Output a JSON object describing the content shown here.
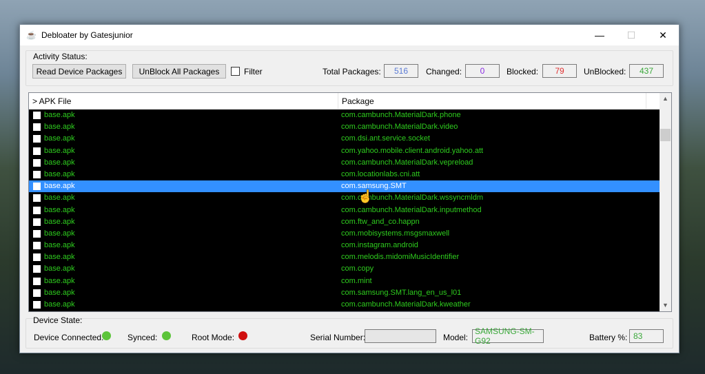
{
  "window": {
    "title": "Debloater by Gatesjunior",
    "minimize": "—",
    "maximize": "☐",
    "close": "✕"
  },
  "activity": {
    "label": "Activity Status:",
    "read_button": "Read Device Packages",
    "unblock_button": "UnBlock All Packages",
    "filter_label": "Filter",
    "filter_checked": false,
    "total_label": "Total Packages:",
    "total": "516",
    "changed_label": "Changed:",
    "changed": "0",
    "blocked_label": "Blocked:",
    "blocked": "79",
    "unblocked_label": "UnBlocked:",
    "unblocked": "437"
  },
  "colors": {
    "total": "#5b7bd5",
    "changed": "#8a2be2",
    "blocked": "#e03030",
    "unblocked": "#3aa83a",
    "row_text": "#2ecc1e",
    "selection": "#3390ff"
  },
  "list": {
    "columns": [
      "> APK File",
      "Package"
    ],
    "selected_index": 6,
    "rows": [
      {
        "apk": "base.apk",
        "package": "com.cambunch.MaterialDark.phone"
      },
      {
        "apk": "base.apk",
        "package": "com.cambunch.MaterialDark.video"
      },
      {
        "apk": "base.apk",
        "package": "com.dsi.ant.service.socket"
      },
      {
        "apk": "base.apk",
        "package": "com.yahoo.mobile.client.android.yahoo.att"
      },
      {
        "apk": "base.apk",
        "package": "com.cambunch.MaterialDark.vepreload"
      },
      {
        "apk": "base.apk",
        "package": "com.locationlabs.cni.att"
      },
      {
        "apk": "base.apk",
        "package": "com.samsung.SMT"
      },
      {
        "apk": "base.apk",
        "package": "com.cambunch.MaterialDark.wssyncmldm"
      },
      {
        "apk": "base.apk",
        "package": "com.cambunch.MaterialDark.inputmethod"
      },
      {
        "apk": "base.apk",
        "package": "com.ftw_and_co.happn"
      },
      {
        "apk": "base.apk",
        "package": "com.mobisystems.msgsmaxwell"
      },
      {
        "apk": "base.apk",
        "package": "com.instagram.android"
      },
      {
        "apk": "base.apk",
        "package": "com.melodis.midomiMusicIdentifier"
      },
      {
        "apk": "base.apk",
        "package": "com.copy"
      },
      {
        "apk": "base.apk",
        "package": "com.mint"
      },
      {
        "apk": "base.apk",
        "package": "com.samsung.SMT.lang_en_us_l01"
      },
      {
        "apk": "base.apk",
        "package": "com.cambunch.MaterialDark.kweather"
      }
    ]
  },
  "device": {
    "label": "Device State:",
    "connected_label": "Device Connected:",
    "synced_label": "Synced:",
    "root_label": "Root Mode:",
    "serial_label": "Serial Number:",
    "serial": "",
    "model_label": "Model:",
    "model": "SAMSUNG-SM-G92",
    "battery_label": "Battery %:",
    "battery": "83",
    "connected_color": "#5cc43a",
    "synced_color": "#5cc43a",
    "root_color": "#d01010"
  }
}
